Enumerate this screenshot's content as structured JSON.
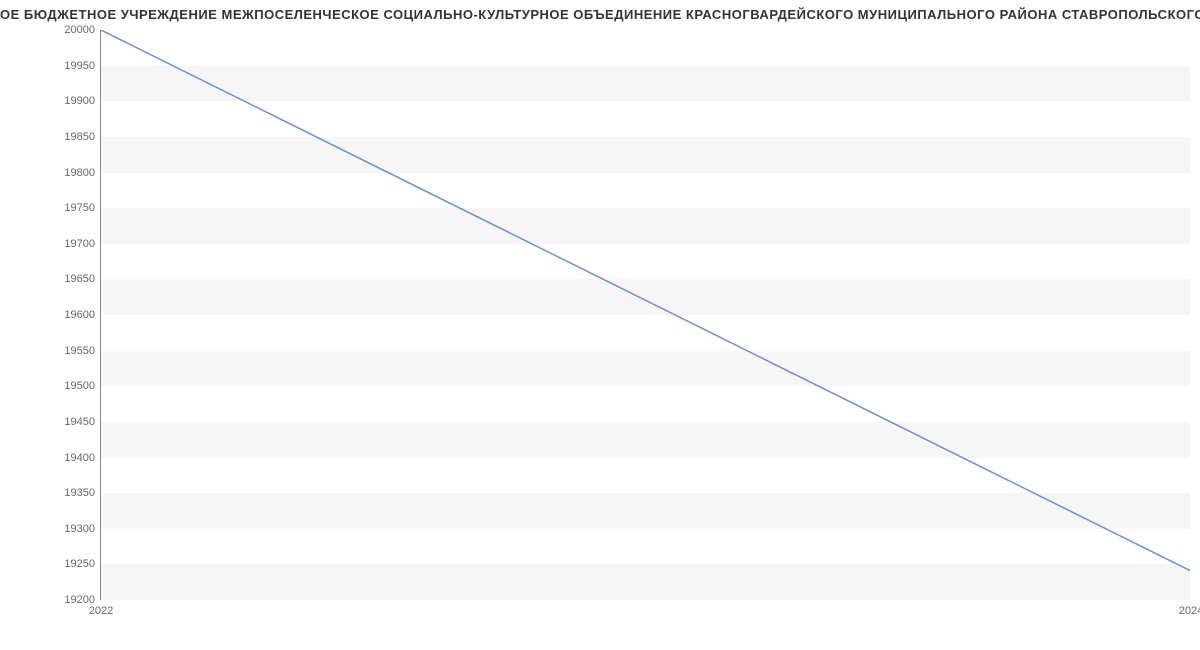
{
  "chart_data": {
    "type": "line",
    "title": "ОЕ БЮДЖЕТНОЕ УЧРЕЖДЕНИЕ МЕЖПОСЕЛЕНЧЕСКОЕ СОЦИАЛЬНО-КУЛЬТУРНОЕ ОБЪЕДИНЕНИЕ КРАСНОГВАРДЕЙСКОГО МУНИЦИПАЛЬНОГО РАЙОНА СТАВРОПОЛЬСКОГО",
    "x": [
      2022,
      2024
    ],
    "values": [
      20000,
      19240
    ],
    "xlabel": "",
    "ylabel": "",
    "ylim": [
      19200,
      20000
    ],
    "y_ticks": [
      19200,
      19250,
      19300,
      19350,
      19400,
      19450,
      19500,
      19550,
      19600,
      19650,
      19700,
      19750,
      19800,
      19850,
      19900,
      19950,
      20000
    ],
    "x_ticks": [
      2022,
      2024
    ],
    "line_color": "#6b8fd6"
  }
}
